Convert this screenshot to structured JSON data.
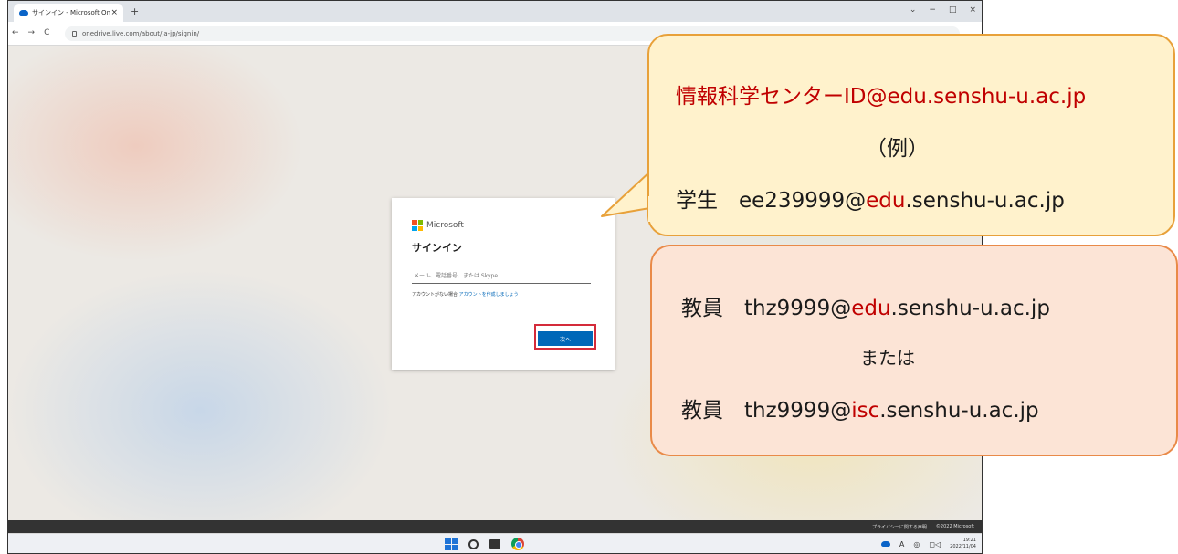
{
  "browser": {
    "tab_title": "サインイン - Microsoft OneDrive",
    "tab_close": "×",
    "new_tab": "+",
    "window_controls": [
      "⌄",
      "−",
      "□",
      "×"
    ],
    "nav": [
      "←",
      "→",
      "C"
    ],
    "url": "onedrive.live.com/about/ja-jp/signin/"
  },
  "signin": {
    "brand": "Microsoft",
    "title": "サインイン",
    "input_placeholder": "メール、電話番号、または Skype",
    "no_account_text": "アカウントがない場合 ",
    "create_account_link": "アカウントを作成しましょう",
    "next_button": "次へ"
  },
  "footer": {
    "privacy": "プライバシーに関する声明",
    "copyright": "©2022 Microsoft"
  },
  "taskbar": {
    "tray_ime": "A",
    "clock_time": "19:21",
    "clock_date": "2022/11/04"
  },
  "callout_top": {
    "line1": "情報科学センターID@edu.senshu-u.ac.jp",
    "line2": "（例）",
    "line3_prefix": "学生　ee239999@",
    "line3_domain": "edu",
    "line3_suffix": ".senshu-u.ac.jp"
  },
  "callout_bottom": {
    "line1_prefix": "教員　thz9999@",
    "line1_domain": "edu",
    "line1_suffix": ".senshu-u.ac.jp",
    "or": "または",
    "line3_prefix": "教員　thz9999@",
    "line3_domain": "isc",
    "line3_suffix": ".senshu-u.ac.jp"
  },
  "colors": {
    "accent_red": "#c00000",
    "ms_blue": "#0067b8",
    "callout_yellow": "#fff2cc",
    "callout_orange": "#fce4d6"
  }
}
